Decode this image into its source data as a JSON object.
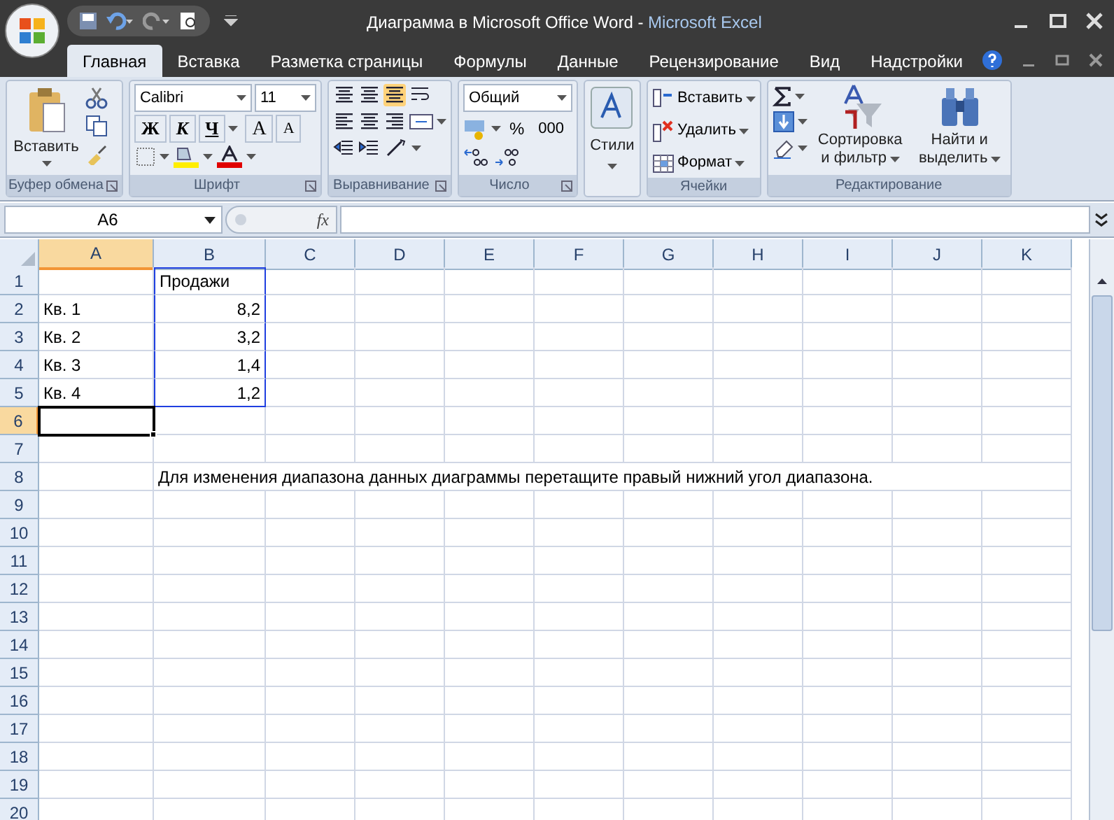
{
  "window": {
    "document": "Диаграмма в Microsoft Office Word",
    "separator": " - ",
    "app": "Microsoft Excel"
  },
  "tabs": [
    {
      "label": "Главная",
      "selected": true
    },
    {
      "label": "Вставка",
      "selected": false
    },
    {
      "label": "Разметка страницы",
      "selected": false
    },
    {
      "label": "Формулы",
      "selected": false
    },
    {
      "label": "Данные",
      "selected": false
    },
    {
      "label": "Рецензирование",
      "selected": false
    },
    {
      "label": "Вид",
      "selected": false
    },
    {
      "label": "Надстройки",
      "selected": false
    }
  ],
  "ribbon": [
    {
      "kind": "clipboard",
      "label": "Буфер обмена",
      "paste": "Вставить"
    },
    {
      "kind": "font",
      "label": "Шрифт",
      "font": "Calibri",
      "size": "11",
      "bold": "Ж",
      "italic": "К",
      "underline": "Ч",
      "grow": "A",
      "shrink": "A"
    },
    {
      "kind": "alignment",
      "label": "Выравнивание"
    },
    {
      "kind": "number",
      "label": "Число",
      "format": "Общий",
      "percent": "%",
      "thousands": "000"
    },
    {
      "kind": "styles",
      "label": "Стили"
    },
    {
      "kind": "cells",
      "label": "Ячейки",
      "insert": "Вставить",
      "delete": "Удалить",
      "format": "Формат"
    },
    {
      "kind": "editing",
      "label": "Редактирование",
      "sort": "Сортировка",
      "sort2": "и фильтр",
      "find": "Найти и",
      "find2": "выделить"
    }
  ],
  "formula_bar": {
    "name_box": "A6",
    "fx": "fx"
  },
  "sheet": {
    "columns": [
      {
        "label": "A",
        "selected": true
      },
      {
        "label": "B",
        "selected": false
      },
      {
        "label": "C",
        "selected": false
      },
      {
        "label": "D",
        "selected": false
      },
      {
        "label": "E",
        "selected": false
      },
      {
        "label": "F",
        "selected": false
      },
      {
        "label": "G",
        "selected": false
      },
      {
        "label": "H",
        "selected": false
      },
      {
        "label": "I",
        "selected": false
      },
      {
        "label": "J",
        "selected": false
      },
      {
        "label": "K",
        "selected": false
      }
    ],
    "rows": [
      {
        "number": "1",
        "selected": false,
        "cells": [
          {
            "text": ""
          },
          {
            "text": "Продажи",
            "in_range": true
          }
        ]
      },
      {
        "number": "2",
        "selected": false,
        "cells": [
          {
            "text": "Кв. 1"
          },
          {
            "text": "8,2",
            "kind": "number",
            "in_range": true
          }
        ]
      },
      {
        "number": "3",
        "selected": false,
        "cells": [
          {
            "text": "Кв. 2"
          },
          {
            "text": "3,2",
            "kind": "number",
            "in_range": true
          }
        ]
      },
      {
        "number": "4",
        "selected": false,
        "cells": [
          {
            "text": "Кв. 3"
          },
          {
            "text": "1,4",
            "kind": "number",
            "in_range": true
          }
        ]
      },
      {
        "number": "5",
        "selected": false,
        "cells": [
          {
            "text": "Кв. 4"
          },
          {
            "text": "1,2",
            "kind": "number",
            "in_range": true
          }
        ]
      },
      {
        "number": "6",
        "selected": true,
        "cells": []
      },
      {
        "number": "7",
        "selected": false,
        "cells": []
      },
      {
        "number": "8",
        "selected": false,
        "cells": [
          {
            "text": ""
          },
          {
            "text": "Для изменения диапазона данных диаграммы перетащите правый нижний угол диапазона.",
            "kind": "note"
          }
        ]
      },
      {
        "number": "9",
        "selected": false,
        "cells": []
      },
      {
        "number": "10",
        "selected": false,
        "cells": []
      },
      {
        "number": "11",
        "selected": false,
        "cells": []
      },
      {
        "number": "12",
        "selected": false,
        "cells": []
      },
      {
        "number": "13",
        "selected": false,
        "cells": []
      },
      {
        "number": "14",
        "selected": false,
        "cells": []
      },
      {
        "number": "15",
        "selected": false,
        "cells": []
      },
      {
        "number": "16",
        "selected": false,
        "cells": []
      },
      {
        "number": "17",
        "selected": false,
        "cells": []
      },
      {
        "number": "18",
        "selected": false,
        "cells": []
      },
      {
        "number": "19",
        "selected": false,
        "cells": []
      },
      {
        "number": "20",
        "selected": false,
        "cells": []
      }
    ]
  }
}
